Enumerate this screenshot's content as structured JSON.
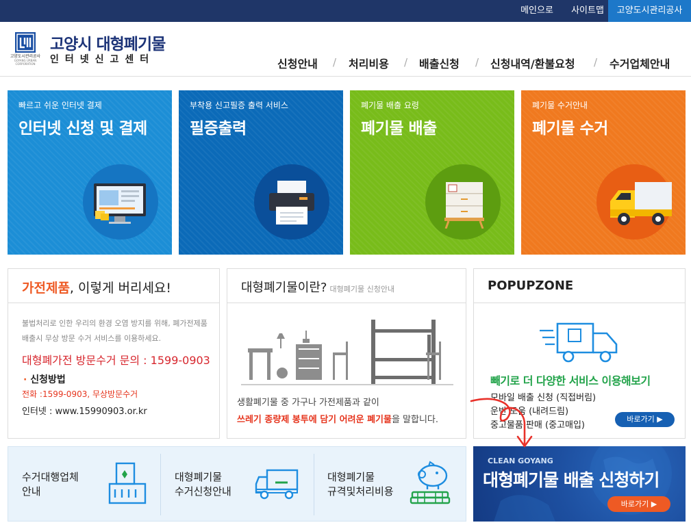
{
  "topbar": {
    "links": [
      "메인으로",
      "사이트맵",
      "고양도시관리공사"
    ]
  },
  "header": {
    "logo_org": "고양도시관리공사",
    "logo_org_en": "GOYANG URBAN CORPORATION",
    "title": "고양시 대형폐기물",
    "subtitle": "인터넷신고센터",
    "nav": [
      "신청안내",
      "처리비용",
      "배출신청",
      "신청내역/환불요청",
      "수거업체안내"
    ]
  },
  "tiles": [
    {
      "small": "빠르고 쉬운 인터넷 결제",
      "big": "인터넷 신청 및 결제",
      "color": "#1c8ed6",
      "circle": "#1575c2",
      "icon": "monitor-icon"
    },
    {
      "small": "부착용 신고필증 출력 서비스",
      "big": "필증출력",
      "color": "#0b6ab8",
      "circle": "#0a4f9a",
      "icon": "printer-icon"
    },
    {
      "small": "폐기물 배출 요령",
      "big": "폐기물 배출",
      "color": "#78bc1a",
      "circle": "#5d9d10",
      "icon": "cabinet-icon"
    },
    {
      "small": "폐기물 수거안내",
      "big": "폐기물 수거",
      "color": "#f0791f",
      "circle": "#e85e14",
      "icon": "truck-icon"
    }
  ],
  "appliance": {
    "title_highlight": "가전제품",
    "title_rest": ", 이렇게 버리세요!",
    "desc": "불법처리로 인한 우리의 환경 오염 방지를 위해, 폐가전제품 배출시 무상 방문 수거 서비스를 이용하세요.",
    "phone": "대형폐가전 방문수거 문의 : 1599-0903",
    "method_label": "신청방법",
    "method_phone": "전화 :1599-0903, 무상방문수거",
    "method_web": "인터넷 : www.15990903.or.kr"
  },
  "whatis": {
    "title": "대형폐기물이란?",
    "title_sub": "대형폐기물 신청안내",
    "line1": "생활폐기물 중 가구나 가전제품과 같이",
    "line2_highlight": "쓰레기 종량제 봉투에 담기 어려운 폐기물",
    "line2_rest": "을 말합니다."
  },
  "popup": {
    "title": "POPUPZONE",
    "headline": "빼기로 더 다양한 서비스 이용해보기",
    "items": [
      "모바일 배출 신청 (직접버림)",
      "운반 도움 (내려드림)",
      "중고물품 판매 (중고매입)"
    ],
    "button": "바로가기 ▶"
  },
  "quick": [
    {
      "line1": "수거대행업체",
      "line2": "안내",
      "icon": "building-icon"
    },
    {
      "line1": "대형폐기물",
      "line2": "수거신청안내",
      "icon": "truck-icon"
    },
    {
      "line1": "대형폐기물",
      "line2": "규격및처리비용",
      "icon": "piggy-bank-icon"
    }
  ],
  "banner": {
    "sub": "CLEAN GOYANG",
    "title": "대형폐기물 배출 신청하기",
    "button": "바로가기 ▶"
  }
}
